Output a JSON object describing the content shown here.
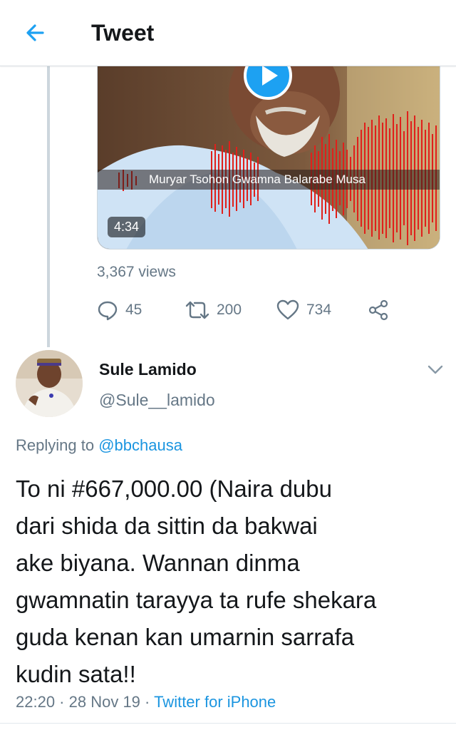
{
  "header": {
    "title": "Tweet",
    "back_icon": "arrow-left-icon",
    "accent_color": "#1da1f2"
  },
  "media": {
    "caption": "Muryar Tsohon Gwamna Balarabe Musa",
    "duration": "4:34",
    "play_icon": "play-icon",
    "waveform_color": "#e0201b"
  },
  "stats": {
    "views": "3,367 views",
    "replies": "45",
    "retweets": "200",
    "likes": "734",
    "reply_icon": "comment-icon",
    "retweet_icon": "retweet-icon",
    "like_icon": "heart-icon",
    "share_icon": "share-icon"
  },
  "reply": {
    "display_name": "Sule Lamido",
    "handle": "@Sule__lamido",
    "replying_prefix": "Replying to ",
    "replying_to": "@bbchausa",
    "text_lines": [
      "To ni #667,000.00 (Naira dubu",
      "dari shida da sittin da bakwai",
      "ake biyana. Wannan dinma",
      "gwamnatin tarayya ta rufe shekara",
      "guda kenan kan umarnin sarrafa",
      "kudin sata!!"
    ],
    "time": "22:20",
    "date": "28 Nov 19",
    "separator": " · ",
    "source": "Twitter for iPhone",
    "caret_icon": "chevron-down-icon",
    "link_color": "#1b95e0"
  }
}
